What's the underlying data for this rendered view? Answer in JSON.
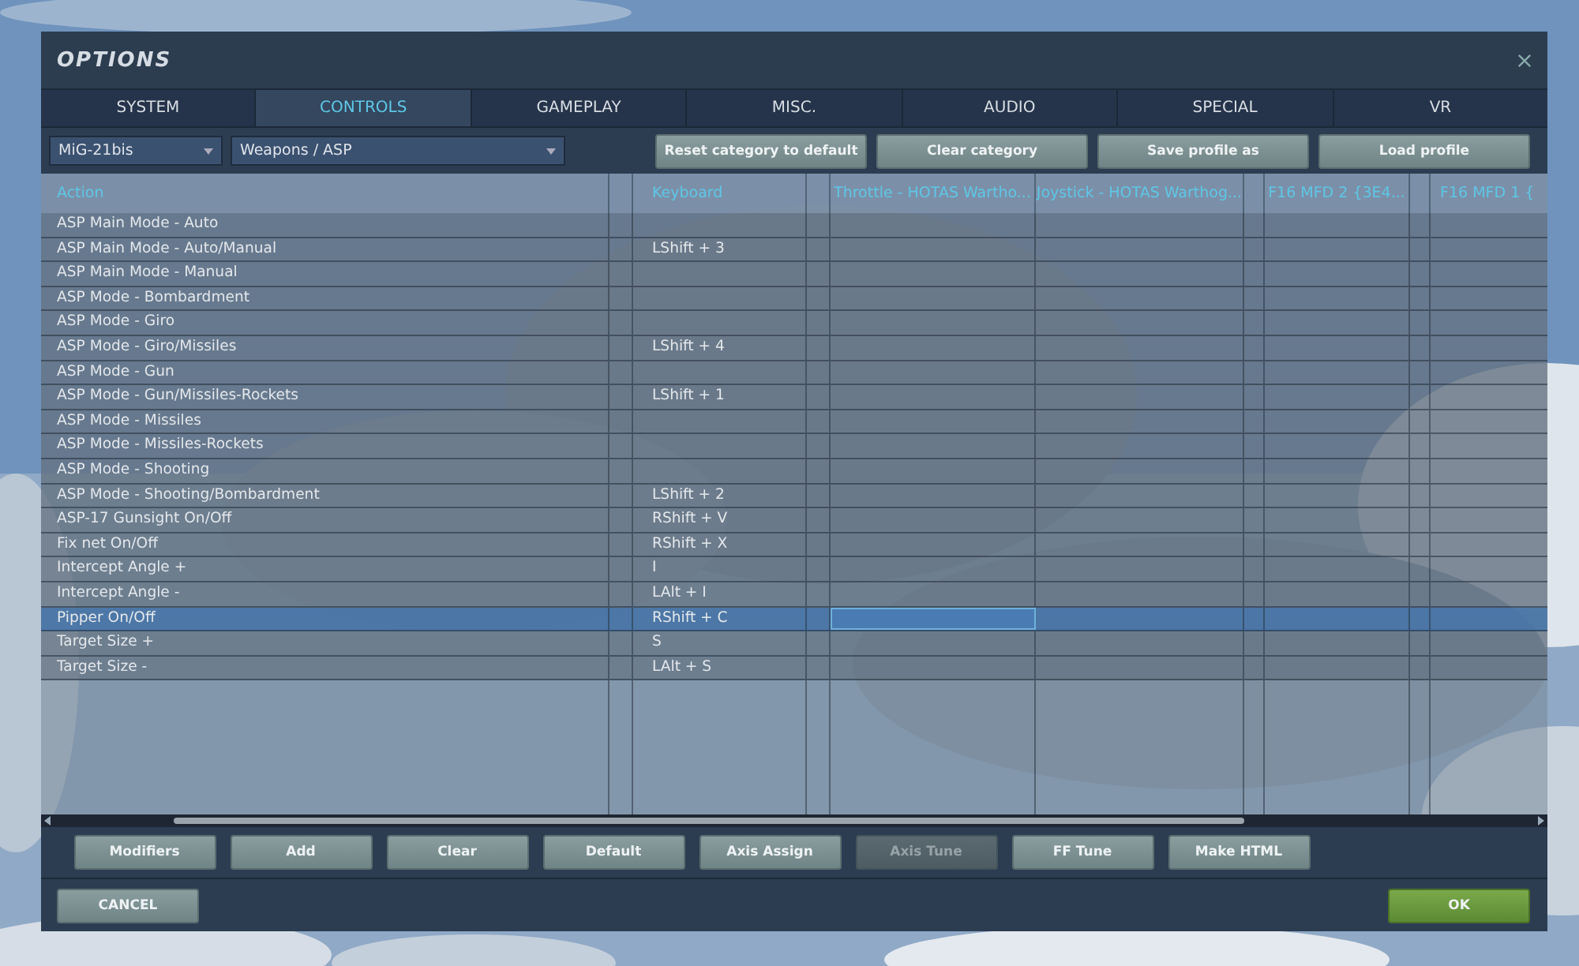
{
  "window": {
    "title": "OPTIONS"
  },
  "tabs": [
    {
      "label": "SYSTEM",
      "selected": false
    },
    {
      "label": "CONTROLS",
      "selected": true
    },
    {
      "label": "GAMEPLAY",
      "selected": false
    },
    {
      "label": "MISC.",
      "selected": false
    },
    {
      "label": "AUDIO",
      "selected": false
    },
    {
      "label": "SPECIAL",
      "selected": false
    },
    {
      "label": "VR",
      "selected": false
    }
  ],
  "toolbar": {
    "aircraft": "MiG-21bis",
    "category": "Weapons / ASP",
    "buttons": [
      "Reset category to default",
      "Clear category",
      "Save profile as",
      "Load profile"
    ]
  },
  "table": {
    "columns": {
      "action": "Action",
      "keyboard": "Keyboard",
      "devices": [
        "Throttle - HOTAS Wartho...",
        "Joystick - HOTAS Warthog...",
        "F16 MFD 2 {3E4...",
        "F16 MFD 1 {"
      ]
    },
    "rows": [
      {
        "action": "ASP Main Mode - Auto",
        "selected": false,
        "throttle_cell_selected": false
      },
      {
        "action": "ASP Main Mode - Auto/Manual",
        "keyboard": "LShift + 3",
        "selected": false,
        "throttle_cell_selected": false
      },
      {
        "action": "ASP Main Mode - Manual",
        "selected": false,
        "throttle_cell_selected": false
      },
      {
        "action": "ASP Mode - Bombardment",
        "selected": false,
        "throttle_cell_selected": false
      },
      {
        "action": "ASP Mode - Giro",
        "selected": false,
        "throttle_cell_selected": false
      },
      {
        "action": "ASP Mode - Giro/Missiles",
        "keyboard": "LShift + 4",
        "selected": false,
        "throttle_cell_selected": false
      },
      {
        "action": "ASP Mode - Gun",
        "selected": false,
        "throttle_cell_selected": false
      },
      {
        "action": "ASP Mode - Gun/Missiles-Rockets",
        "keyboard": "LShift + 1",
        "selected": false,
        "throttle_cell_selected": false
      },
      {
        "action": "ASP Mode - Missiles",
        "selected": false,
        "throttle_cell_selected": false
      },
      {
        "action": "ASP Mode - Missiles-Rockets",
        "selected": false,
        "throttle_cell_selected": false
      },
      {
        "action": "ASP Mode - Shooting",
        "selected": false,
        "throttle_cell_selected": false
      },
      {
        "action": "ASP Mode - Shooting/Bombardment",
        "keyboard": "LShift + 2",
        "selected": false,
        "throttle_cell_selected": false
      },
      {
        "action": "ASP-17 Gunsight On/Off",
        "keyboard": "RShift + V",
        "selected": false,
        "throttle_cell_selected": false
      },
      {
        "action": "Fix net On/Off",
        "keyboard": "RShift + X",
        "selected": false,
        "throttle_cell_selected": false
      },
      {
        "action": "Intercept Angle +",
        "keyboard": "I",
        "selected": false,
        "throttle_cell_selected": false
      },
      {
        "action": "Intercept Angle -",
        "keyboard": "LAlt + I",
        "selected": false,
        "throttle_cell_selected": false
      },
      {
        "action": "Pipper On/Off",
        "keyboard": "RShift + C",
        "selected": true,
        "throttle_cell_selected": true
      },
      {
        "action": "Target Size +",
        "keyboard": "S",
        "selected": false,
        "throttle_cell_selected": false
      },
      {
        "action": "Target Size -",
        "keyboard": "LAlt + S",
        "selected": false,
        "throttle_cell_selected": false
      }
    ]
  },
  "bottom_buttons": [
    {
      "label": "Modifiers",
      "disabled": false
    },
    {
      "label": "Add",
      "disabled": false
    },
    {
      "label": "Clear",
      "disabled": false
    },
    {
      "label": "Default",
      "disabled": false
    },
    {
      "label": "Axis Assign",
      "disabled": false
    },
    {
      "label": "Axis Tune",
      "disabled": true
    },
    {
      "label": "FF Tune",
      "disabled": false
    },
    {
      "label": "Make HTML",
      "disabled": false
    }
  ],
  "footer": [
    {
      "label": "CANCEL",
      "primary": false
    },
    {
      "label": "OK",
      "primary": true
    }
  ]
}
